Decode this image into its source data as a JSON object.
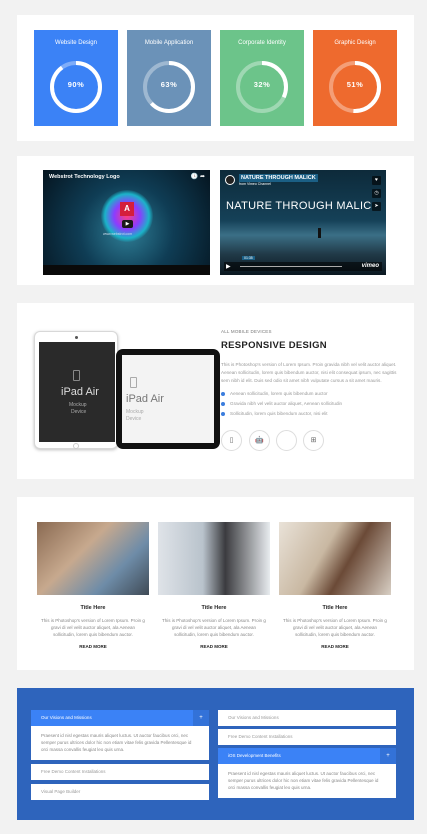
{
  "progress_tiles": [
    {
      "title": "Website Design",
      "percent": 90,
      "label": "90%",
      "color": "#3b82f6"
    },
    {
      "title": "Mobile Application",
      "percent": 63,
      "label": "63%",
      "color": "#6b92b8"
    },
    {
      "title": "Corporate Identity",
      "percent": 32,
      "label": "32%",
      "color": "#6cc48a"
    },
    {
      "title": "Graphic Design",
      "percent": 51,
      "label": "51%",
      "color": "#ee6a2e"
    }
  ],
  "videos": {
    "left": {
      "title": "Webstrot Technology Logo",
      "url": "www.webstrot.com",
      "play": "▶"
    },
    "right": {
      "title": "NATURE THROUGH MALICK",
      "byline": "from Vimeo Channel",
      "overlay": "NATURE THROUGH MALIC",
      "time": "01:35",
      "brand": "vimeo"
    }
  },
  "responsive": {
    "kicker": "ALL MOBILE DEVICES",
    "heading": "RESPONSIVE DESIGN",
    "paragraph": "This is Photoshop's version of Lorem Ipsum. Proin gravida nibh vel velit auctor aliquet. Aenean sollicitudin, lorem quis bibendum auctor, nisi elit consequat ipsum, nec sagittis sem nibh id elit. Duis sed odio sit amet nibh vulputate cursus a sit amet mauris.",
    "bullets": [
      "Aenean sollicitudin, lorem quis bibendum auctor",
      "Gravida nibh vel velit auctor aliquet, Aenean sollicitudin",
      "Sollicitudin, lorem quis bibendum auctor, nisi elit"
    ],
    "device1": {
      "name": "iPad Air",
      "sub1": "Mockup",
      "sub2": "Device"
    },
    "device2": {
      "name": "iPad Air",
      "sub1": "Mockup",
      "sub2": "Device"
    },
    "platform_icons": [
      "phone-icon",
      "android-icon",
      "apple-icon",
      "windows-icon"
    ]
  },
  "cards": [
    {
      "title": "Title Here",
      "text": "This is Photoshop's version of Lorem Ipsum. Proin g gravi di vel velit auctor aliquet, ala Aenean sollicitudin, lorem quis bibendum auctor.",
      "more": "READ MORE"
    },
    {
      "title": "Title Here",
      "text": "This is Photoshop's version of Lorem Ipsum. Proin g gravi di vel velit auctor aliquet, ala Aenean sollicitudin, lorem quis bibendum auctor.",
      "more": "READ MORE"
    },
    {
      "title": "Title Here",
      "text": "This is Photoshop's version of Lorem Ipsum. Proin g gravi di vel velit auctor aliquet, ala Aenean sollicitudin, lorem quis bibendum auctor.",
      "more": "READ MORE"
    }
  ],
  "accordion": {
    "left": [
      {
        "label": "Our Visions and Missions",
        "active": true,
        "toggle": "+"
      },
      {
        "label": "Free Demo Content Installations",
        "active": false
      },
      {
        "label": "Visual Page Builder",
        "active": false
      }
    ],
    "left_body": "Praesent id nisl egestas mauris aliquet luctus. Ut auctor faucibus orci, nec semper purus ultrices dolor hic non etiam vitae felis gravida Pellentesque id orci massa convallis feugiat leo quis urna.",
    "right": [
      {
        "label": "Our Visions and Missions",
        "active": false
      },
      {
        "label": "Free Demo Content Installations",
        "active": false
      },
      {
        "label": "iOS Development Benefits",
        "active": true,
        "toggle": "+"
      }
    ],
    "right_body": "Praesent id nisl egestas mauris aliquet luctus. Ut auctor faucibus orci, nec semper purus ultrices dolor hic non etiam vitae felis gravida Pellentesque id orci massa convallis feugiat leo quis urna."
  }
}
